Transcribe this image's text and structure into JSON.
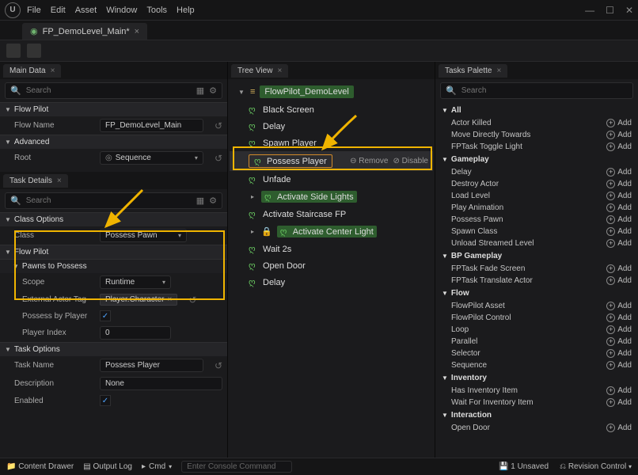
{
  "window": {
    "menus": [
      "File",
      "Edit",
      "Asset",
      "Window",
      "Tools",
      "Help"
    ]
  },
  "doc_tab": {
    "label": "FP_DemoLevel_Main*",
    "close": "×"
  },
  "panels": {
    "main_data": {
      "title": "Main Data",
      "search_placeholder": "Search",
      "sections": {
        "flow_pilot": "Flow Pilot",
        "advanced": "Advanced"
      },
      "flow_name_label": "Flow Name",
      "flow_name_value": "FP_DemoLevel_Main",
      "root_label": "Root",
      "root_value": "Sequence"
    },
    "task_details": {
      "title": "Task Details",
      "search_placeholder": "Search",
      "class_options_hdr": "Class Options",
      "class_label": "Class",
      "class_value": "Possess Pawn",
      "flow_pilot_hdr": "Flow Pilot",
      "pawns_hdr": "Pawns to Possess",
      "scope_label": "Scope",
      "scope_value": "Runtime",
      "ext_tag_label": "External Actor Tag",
      "ext_tag_value": "Player.Character",
      "possess_by_label": "Possess by Player",
      "possess_by_value": true,
      "player_idx_label": "Player Index",
      "player_idx_value": "0",
      "task_options_hdr": "Task Options",
      "task_name_label": "Task Name",
      "task_name_value": "Possess Player",
      "desc_label": "Description",
      "desc_value": "None",
      "enabled_label": "Enabled",
      "enabled_value": true
    },
    "tree_view": {
      "title": "Tree View",
      "root": "FlowPilot_DemoLevel",
      "items": [
        {
          "label": "Black Screen",
          "kind": "leaf"
        },
        {
          "label": "Delay",
          "kind": "leaf"
        },
        {
          "label": "Spawn Player",
          "kind": "leaf"
        },
        {
          "label": "Possess Player",
          "kind": "selected",
          "remove": "Remove",
          "disable": "Disable"
        },
        {
          "label": "Unfade",
          "kind": "leaf"
        },
        {
          "label": "Activate Side Lights",
          "kind": "static"
        },
        {
          "label": "Activate Staircase FP",
          "kind": "leaf"
        },
        {
          "label": "Activate Center Light",
          "kind": "static-lock"
        },
        {
          "label": "Wait 2s",
          "kind": "leaf"
        },
        {
          "label": "Open Door",
          "kind": "leaf"
        },
        {
          "label": "Delay",
          "kind": "leaf"
        }
      ]
    },
    "palette": {
      "title": "Tasks Palette",
      "search_placeholder": "Search",
      "add_label": "Add",
      "categories": [
        {
          "name": "All",
          "items": [
            "Actor Killed",
            "Move Directly Towards",
            "FPTask Toggle Light"
          ]
        },
        {
          "name": "Gameplay",
          "items": [
            "Delay",
            "Destroy Actor",
            "Load Level",
            "Play Animation",
            "Possess Pawn",
            "Spawn Class",
            "Unload Streamed Level"
          ]
        },
        {
          "name": "BP Gameplay",
          "items": [
            "FPTask Fade Screen",
            "FPTask Translate Actor"
          ]
        },
        {
          "name": "Flow",
          "items": [
            "FlowPilot Asset",
            "FlowPilot Control",
            "Loop",
            "Parallel",
            "Selector",
            "Sequence"
          ]
        },
        {
          "name": "Inventory",
          "items": [
            "Has Inventory Item",
            "Wait For Inventory Item"
          ]
        },
        {
          "name": "Interaction",
          "items": [
            "Open Door"
          ]
        }
      ]
    }
  },
  "status": {
    "content_drawer": "Content Drawer",
    "output_log": "Output Log",
    "cmd_label": "Cmd",
    "cmd_placeholder": "Enter Console Command",
    "unsaved": "1 Unsaved",
    "revision": "Revision Control"
  }
}
